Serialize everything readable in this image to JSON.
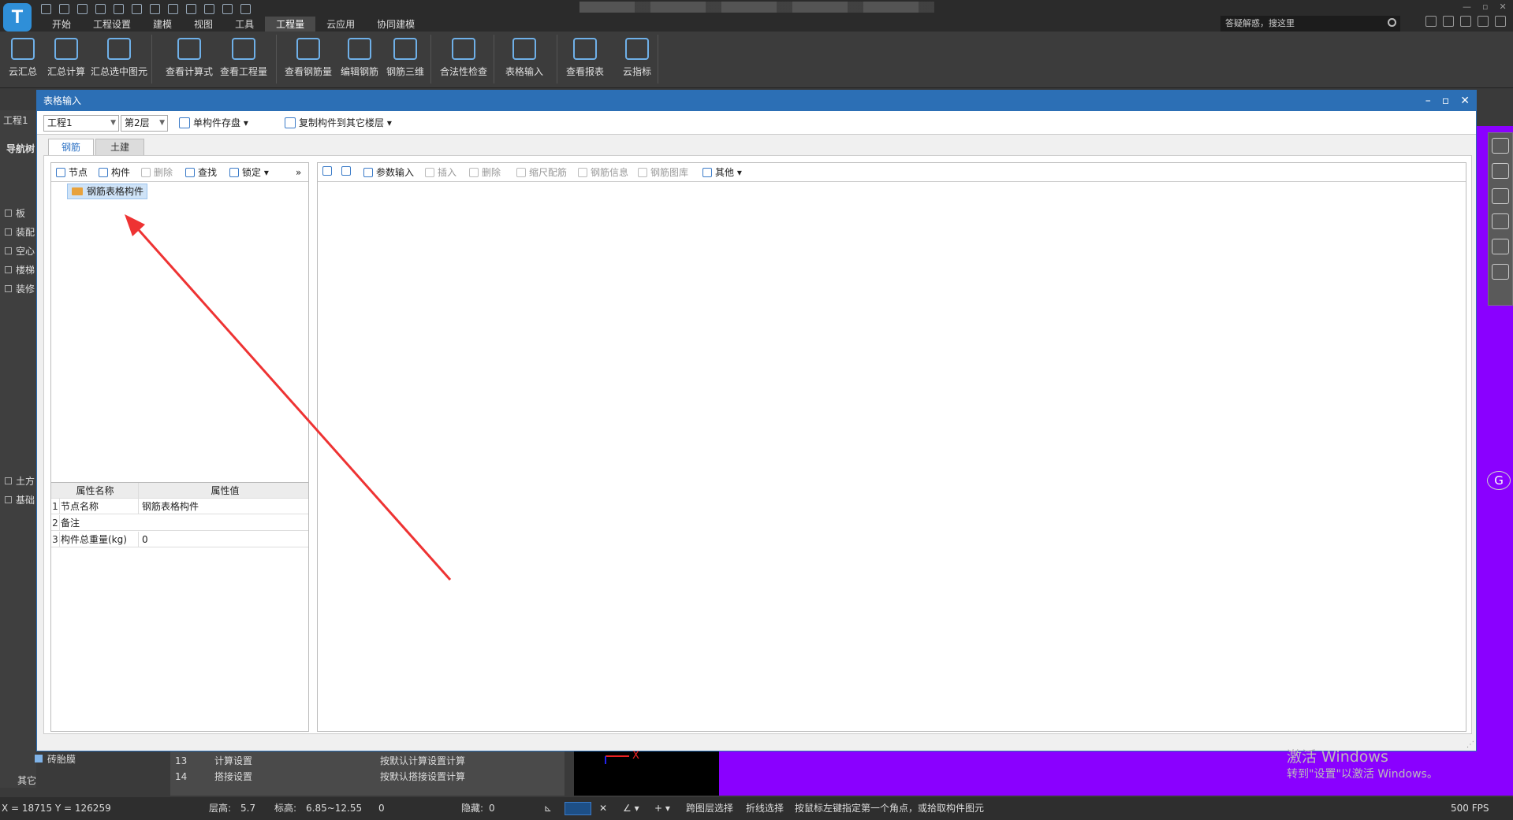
{
  "menu": [
    "开始",
    "工程设置",
    "建模",
    "视图",
    "工具",
    "工程量",
    "云应用",
    "协同建模"
  ],
  "menu_active": "工程量",
  "search_placeholder": "答疑解惑，搜这里",
  "ribbon": [
    "云汇总",
    "汇总计算",
    "汇总选中图元",
    "查看计算式",
    "查看工程量",
    "查看钢筋量",
    "编辑钢筋",
    "钢筋三维",
    "合法性检查",
    "表格输入",
    "查看报表",
    "云指标"
  ],
  "left_tab": "工程1",
  "left_nav_title": "导航树",
  "left_tree": [
    "板",
    "装配",
    "空心",
    "楼梯",
    "装修",
    "土方",
    "基础",
    "其它"
  ],
  "dialog": {
    "title": "表格输入",
    "project_combo": "工程1",
    "floor_combo": "第2层",
    "save_btn": "单构件存盘",
    "copy_btn": "复制构件到其它楼层",
    "tabs": [
      "钢筋",
      "土建"
    ],
    "left_toolbar": [
      "节点",
      "构件",
      "删除",
      "查找",
      "锁定"
    ],
    "tree_node": "钢筋表格构件",
    "prop_headers": [
      "属性名称",
      "属性值"
    ],
    "props": [
      {
        "n": "1",
        "k": "节点名称",
        "v": "钢筋表格构件"
      },
      {
        "n": "2",
        "k": "备注",
        "v": ""
      },
      {
        "n": "3",
        "k": "构件总重量(kg)",
        "v": "0"
      }
    ],
    "right_toolbar": [
      "参数输入",
      "插入",
      "删除",
      "缩尺配筋",
      "钢筋信息",
      "钢筋图库",
      "其他"
    ]
  },
  "bottom_grid": [
    {
      "n": "13",
      "name": "计算设置",
      "val": "按默认计算设置计算"
    },
    {
      "n": "14",
      "name": "搭接设置",
      "val": "按默认搭接设置计算"
    }
  ],
  "brick": "砖胎膜",
  "watermark": "激活 Windows",
  "watermark2": "转到\"设置\"以激活 Windows。",
  "status": {
    "coords": "X = 18715 Y = 126259",
    "floor_h_label": "层高:",
    "floor_h": "5.7",
    "elev_label": "标高:",
    "elev": "6.85~12.55",
    "zero": "0",
    "hidden_label": "隐藏:",
    "hidden": "0",
    "cross_select": "跨图层选择",
    "polyline_select": "折线选择",
    "hint": "按鼠标左键指定第一个角点，或拾取构件图元",
    "fps": "500 FPS"
  },
  "g_label": "G",
  "axis_x": "X"
}
